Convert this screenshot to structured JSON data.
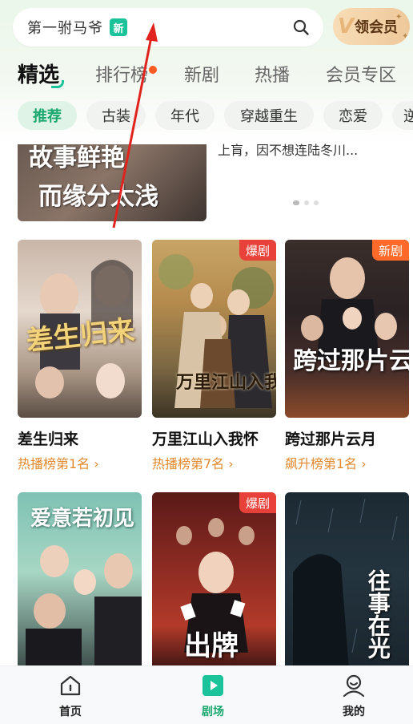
{
  "search": {
    "text": "第一驸马爷",
    "badge": "新",
    "icon": "search-icon"
  },
  "vip": {
    "letter": "V",
    "label": "领会员"
  },
  "tabs": [
    {
      "label": "精选",
      "active": true
    },
    {
      "label": "排行榜",
      "dot": true
    },
    {
      "label": "新剧"
    },
    {
      "label": "热播"
    },
    {
      "label": "会员专区"
    }
  ],
  "chips": [
    "推荐",
    "古装",
    "年代",
    "穿越重生",
    "恋爱",
    "逆"
  ],
  "banner": {
    "poster_line1": "故事鲜艳",
    "poster_line2": "而缘分太浅",
    "text": "上肓，因不想连陆冬川..."
  },
  "cards": [
    {
      "title": "差生归来",
      "rank": "热播榜第1名 ›",
      "tag": "",
      "poster_text": "差生归来"
    },
    {
      "title": "万里江山入我怀",
      "rank": "热播榜第7名 ›",
      "tag": "爆剧",
      "poster_text": "万里江山入我怀"
    },
    {
      "title": "跨过那片云月",
      "rank": "飙升榜第1名 ›",
      "tag": "新剧",
      "poster_text": "跨过那片云月"
    },
    {
      "title": "",
      "rank": "",
      "tag": "",
      "poster_text": "爱意若初见"
    },
    {
      "title": "",
      "rank": "",
      "tag": "爆剧",
      "poster_text": "出牌"
    },
    {
      "title": "",
      "rank": "",
      "tag": "",
      "poster_text": "往事在光"
    }
  ],
  "nav": [
    {
      "label": "首页",
      "icon": "home-icon"
    },
    {
      "label": "剧场",
      "icon": "play-icon",
      "active": true
    },
    {
      "label": "我的",
      "icon": "profile-icon"
    }
  ],
  "colors": {
    "accent": "#1aa86f",
    "badge_green": "#1bc39b",
    "tag_red": "#e8413a",
    "tag_orange": "#ff6a2b",
    "rank_orange": "#e2892e"
  }
}
